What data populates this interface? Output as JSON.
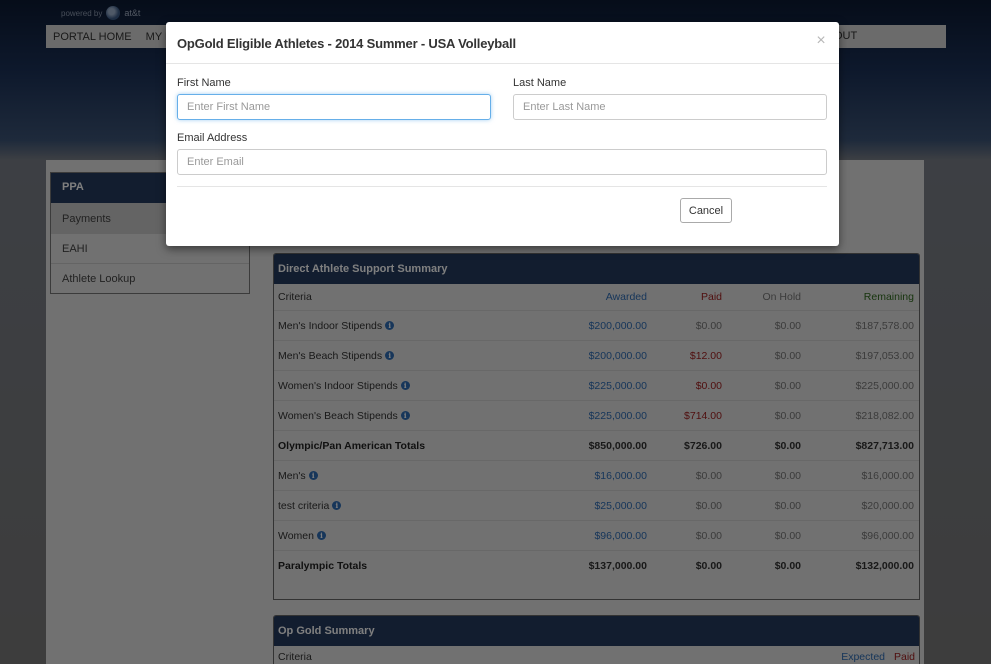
{
  "brand": {
    "powered_by": "powered by",
    "name": "at&t"
  },
  "topnav": {
    "items": [
      "PORTAL HOME",
      "MY P"
    ],
    "logout_partial": "OUT"
  },
  "side_nav": {
    "header": "PPA",
    "items": [
      {
        "label": "Payments",
        "active": true
      },
      {
        "label": "EAHI",
        "active": false
      },
      {
        "label": "Athlete Lookup",
        "active": false
      }
    ]
  },
  "das_summary": {
    "title": "Direct Athlete Support Summary",
    "columns": [
      "Criteria",
      "Awarded",
      "Paid",
      "On Hold",
      "Remaining"
    ],
    "rows": [
      {
        "criteria": "Men's Indoor Stipends",
        "info": true,
        "awarded": "$200,000.00",
        "paid": "$0.00",
        "on_hold": "$0.00",
        "remaining": "$187,578.00",
        "total": false,
        "paid_color": "gray"
      },
      {
        "criteria": "Men's Beach Stipends",
        "info": true,
        "awarded": "$200,000.00",
        "paid": "$12.00",
        "on_hold": "$0.00",
        "remaining": "$197,053.00",
        "total": false,
        "paid_color": "red"
      },
      {
        "criteria": "Women's Indoor Stipends",
        "info": true,
        "awarded": "$225,000.00",
        "paid": "$0.00",
        "on_hold": "$0.00",
        "remaining": "$225,000.00",
        "total": false,
        "paid_color": "red"
      },
      {
        "criteria": "Women's Beach Stipends",
        "info": true,
        "awarded": "$225,000.00",
        "paid": "$714.00",
        "on_hold": "$0.00",
        "remaining": "$218,082.00",
        "total": false,
        "paid_color": "red"
      },
      {
        "criteria": "Olympic/Pan American Totals",
        "info": false,
        "awarded": "$850,000.00",
        "paid": "$726.00",
        "on_hold": "$0.00",
        "remaining": "$827,713.00",
        "total": true,
        "paid_color": "dark"
      },
      {
        "criteria": "Men's",
        "info": true,
        "awarded": "$16,000.00",
        "paid": "$0.00",
        "on_hold": "$0.00",
        "remaining": "$16,000.00",
        "total": false,
        "paid_color": "gray"
      },
      {
        "criteria": "test criteria",
        "info": true,
        "awarded": "$25,000.00",
        "paid": "$0.00",
        "on_hold": "$0.00",
        "remaining": "$20,000.00",
        "total": false,
        "paid_color": "gray"
      },
      {
        "criteria": "Women",
        "info": true,
        "awarded": "$96,000.00",
        "paid": "$0.00",
        "on_hold": "$0.00",
        "remaining": "$96,000.00",
        "total": false,
        "paid_color": "gray"
      },
      {
        "criteria": "Paralympic Totals",
        "info": false,
        "awarded": "$137,000.00",
        "paid": "$0.00",
        "on_hold": "$0.00",
        "remaining": "$132,000.00",
        "total": true,
        "paid_color": "dark"
      }
    ]
  },
  "op_gold_summary": {
    "title": "Op Gold Summary",
    "columns": [
      "Criteria",
      "Expected",
      "Paid"
    ]
  },
  "modal": {
    "title": "OpGold Eligible Athletes - 2014 Summer - USA Volleyball",
    "close_glyph": "×",
    "first_name": {
      "label": "First Name",
      "placeholder": "Enter First Name",
      "value": ""
    },
    "last_name": {
      "label": "Last Name",
      "placeholder": "Enter Last Name",
      "value": ""
    },
    "email": {
      "label": "Email Address",
      "placeholder": "Enter Email",
      "value": ""
    },
    "cancel_label": "Cancel"
  },
  "colors": {
    "navy_header": "#243b5f",
    "awarded_blue": "#2f6db5",
    "paid_red": "#a02020",
    "remaining_green": "#2f6a1e",
    "focus_blue": "#66afe9"
  }
}
